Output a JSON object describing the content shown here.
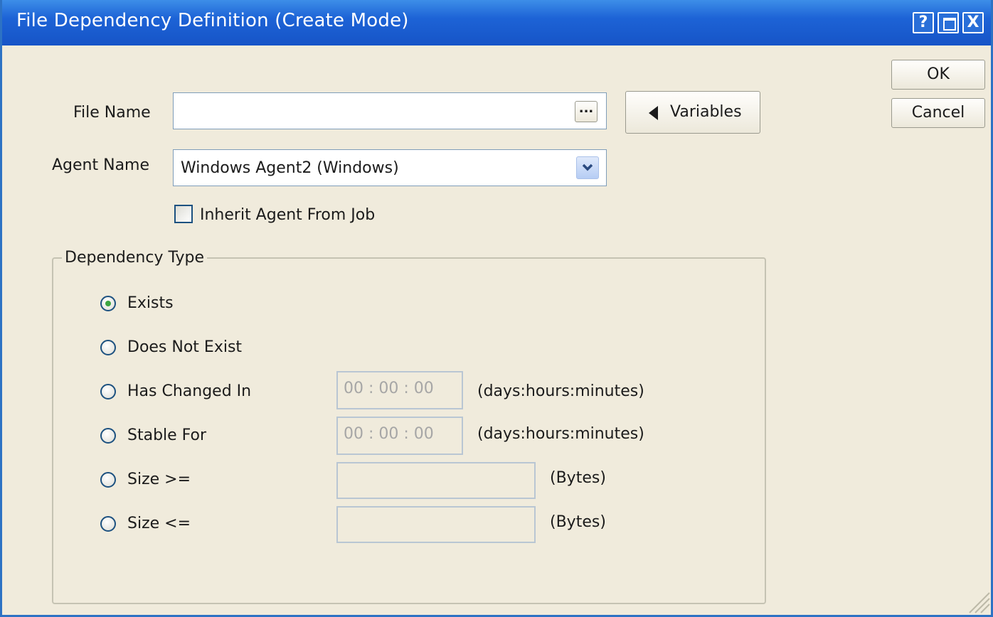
{
  "window": {
    "title": "File Dependency Definition (Create Mode)",
    "controls": {
      "help": "?",
      "maximize": "□",
      "close": "X"
    }
  },
  "actions": {
    "ok_label": "OK",
    "cancel_label": "Cancel"
  },
  "form": {
    "file_name": {
      "label": "File Name",
      "value": "",
      "browse_label": "...",
      "browse_icon": "ellipsis-icon"
    },
    "variables_button": {
      "label": "Variables",
      "icon": "triangle-left-icon"
    },
    "agent_name": {
      "label": "Agent Name",
      "value": "Windows Agent2 (Windows)",
      "icon": "chevron-down-icon"
    },
    "inherit_agent": {
      "label": "Inherit Agent From Job",
      "checked": false
    }
  },
  "dependency_type": {
    "legend": "Dependency Type",
    "selected": "Exists",
    "options": [
      {
        "label": "Exists",
        "selected": true
      },
      {
        "label": "Does Not Exist",
        "selected": false
      },
      {
        "label": "Has Changed In",
        "selected": false,
        "value": "00 : 00 : 00",
        "unit": "(days:hours:minutes)"
      },
      {
        "label": "Stable For",
        "selected": false,
        "value": "00 : 00 : 00",
        "unit": "(days:hours:minutes)"
      },
      {
        "label": "Size >=",
        "selected": false,
        "value": "",
        "unit": "(Bytes)"
      },
      {
        "label": "Size <=",
        "selected": false,
        "value": "",
        "unit": "(Bytes)"
      }
    ]
  },
  "colors": {
    "titlebar": "#1d63d6",
    "background": "#f0ebdc",
    "radio_selected": "#3da541"
  }
}
